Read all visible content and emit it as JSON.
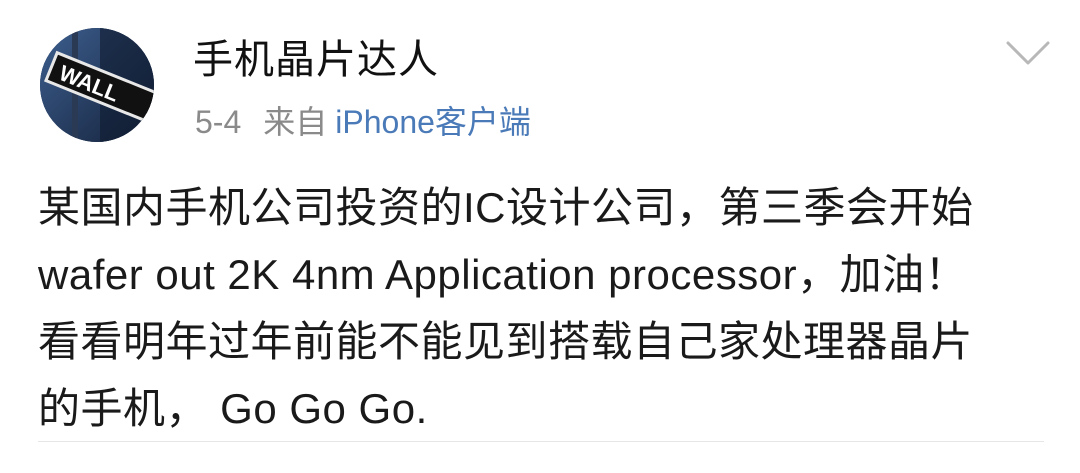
{
  "post": {
    "username": "手机晶片达人",
    "date": "5-4",
    "from_label": "来自",
    "source": "iPhone客户端",
    "avatar_sign_text": "WALL",
    "body_lines": [
      "某国内手机公司投资的IC设计公司，第三季会开始",
      "wafer out 2K 4nm Application processor，加油！",
      "看看明年过年前能不能见到搭载自己家处理器晶片",
      "的手机， Go Go Go."
    ]
  },
  "icons": {
    "menu": "chevron-down-icon"
  },
  "colors": {
    "username": "#111111",
    "meta": "#8a8a8a",
    "source_link": "#4a7ab8",
    "body": "#1a1a1a"
  }
}
